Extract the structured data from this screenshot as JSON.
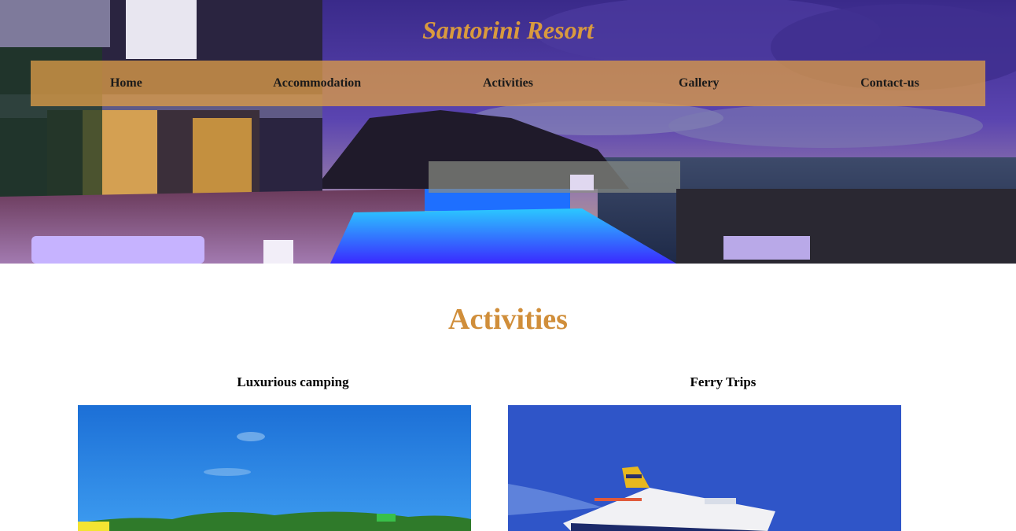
{
  "site": {
    "title": "Santorini Resort"
  },
  "nav": {
    "items": [
      {
        "label": "Home"
      },
      {
        "label": "Accommodation"
      },
      {
        "label": "Activities"
      },
      {
        "label": "Gallery"
      },
      {
        "label": "Contact-us"
      }
    ]
  },
  "main": {
    "heading": "Activities",
    "cards": [
      {
        "title": "Luxurious camping"
      },
      {
        "title": "Ferry Trips"
      }
    ]
  },
  "colors": {
    "accent": "#d99a3e",
    "navbar": "#db9b48"
  }
}
